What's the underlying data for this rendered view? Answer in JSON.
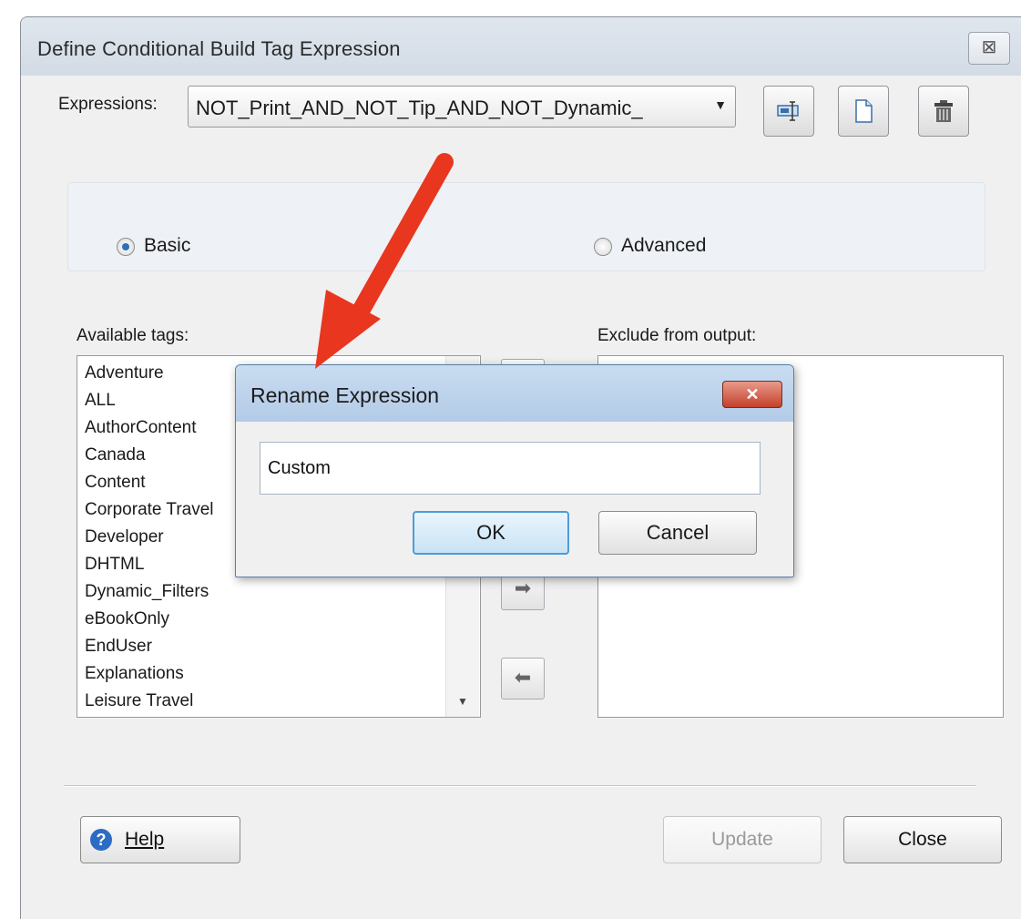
{
  "main_dialog": {
    "title": "Define Conditional Build Tag Expression",
    "close_glyph": "⊠",
    "expressions_label": "Expressions:",
    "expressions_value": "NOT_Print_AND_NOT_Tip_AND_NOT_Dynamic_",
    "toolbar": {
      "rename_icon": "rename-icon",
      "new_icon": "new-document-icon",
      "delete_icon": "trash-icon"
    },
    "mode": {
      "basic_label": "Basic",
      "advanced_label": "Advanced",
      "selected": "Basic"
    },
    "available_tags_label": "Available tags:",
    "available_tags": [
      "Adventure",
      "ALL",
      "AuthorContent",
      "Canada",
      "Content",
      "Corporate Travel",
      "Developer",
      "DHTML",
      "Dynamic_Filters",
      "eBookOnly",
      "EndUser",
      "Explanations",
      "Leisure Travel"
    ],
    "exclude_label": "Exclude from output:",
    "exclude_items": [],
    "help_label": "Help",
    "update_label": "Update",
    "close_label": "Close"
  },
  "rename_dialog": {
    "title": "Rename Expression",
    "close_glyph": "✕",
    "input_value": "Custom",
    "ok_label": "OK",
    "cancel_label": "Cancel"
  },
  "colors": {
    "annotation_arrow": "#e8361f",
    "help_icon": "#2c6cc4",
    "close_button": "#c4402c"
  }
}
